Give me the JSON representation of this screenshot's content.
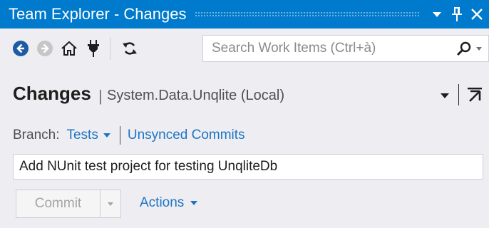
{
  "window": {
    "title": "Team Explorer - Changes",
    "accent": "#007acc"
  },
  "toolbar": {
    "icons": [
      "back-icon",
      "forward-icon",
      "home-icon",
      "connect-icon",
      "refresh-icon"
    ],
    "search": {
      "placeholder": "Search Work Items (Ctrl+à)",
      "value": ""
    }
  },
  "page": {
    "title": "Changes",
    "separator": "|",
    "subtitle": "System.Data.Unqlite (Local)"
  },
  "branch": {
    "label": "Branch:",
    "name": "Tests",
    "unsynced_label": "Unsynced Commits"
  },
  "commit": {
    "message": "Add NUnit test project for testing UnqliteDb",
    "button_label": "Commit",
    "actions_label": "Actions"
  },
  "colors": {
    "link": "#1e74c4",
    "background": "#eeeef2",
    "disabled_text": "#a2a4a5"
  }
}
